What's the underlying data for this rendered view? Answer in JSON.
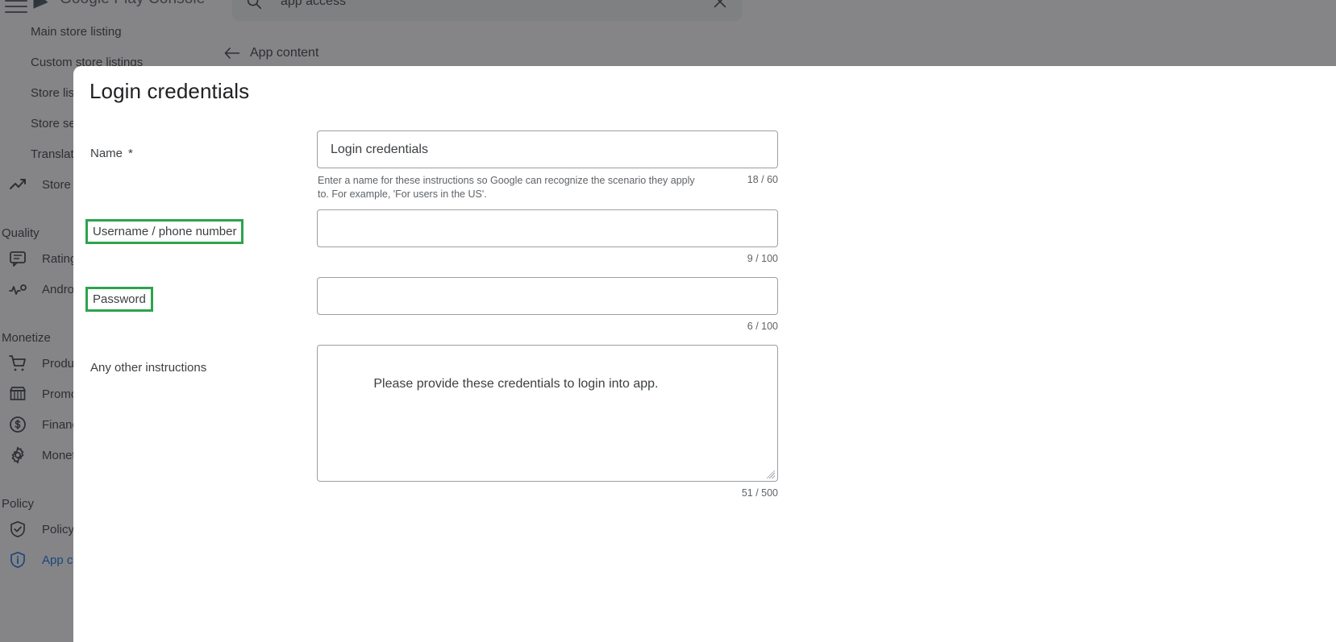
{
  "app": {
    "brand": "Google Play Console",
    "menu_icon": "hamburger-icon",
    "logo_icon": "google-play-logo"
  },
  "search": {
    "icon": "search-icon",
    "value": "app access",
    "clear_icon": "close-icon"
  },
  "breadcrumb": {
    "back_icon": "arrow-left-icon",
    "label": "App content"
  },
  "sidebar": {
    "items": [
      {
        "label": "Main store listing",
        "icon": "",
        "type": "sub",
        "active": false
      },
      {
        "label": "Custom store listings",
        "icon": "",
        "type": "sub",
        "active": false
      },
      {
        "label": "Store listing experiments",
        "icon": "",
        "type": "sub",
        "active": false
      },
      {
        "label": "Store settings",
        "icon": "",
        "type": "sub",
        "active": false
      },
      {
        "label": "Translation service",
        "icon": "",
        "type": "sub",
        "active": false
      },
      {
        "label": "Store performance",
        "icon": "trending-up-icon",
        "type": "item",
        "active": false
      }
    ],
    "sections": [
      {
        "title": "Quality",
        "items": [
          {
            "label": "Ratings and reviews",
            "icon": "reviews-icon",
            "active": false
          },
          {
            "label": "Android vitals",
            "icon": "vitals-icon",
            "active": false
          }
        ]
      },
      {
        "title": "Monetize",
        "items": [
          {
            "label": "Products",
            "icon": "cart-icon",
            "active": false
          },
          {
            "label": "Promo content",
            "icon": "store-icon",
            "active": false
          },
          {
            "label": "Financial reports",
            "icon": "dollar-icon",
            "active": false
          },
          {
            "label": "Monetization setup",
            "icon": "gear-icon",
            "active": false
          }
        ]
      },
      {
        "title": "Policy",
        "items": [
          {
            "label": "Policy status",
            "icon": "shield-check-icon",
            "active": false
          },
          {
            "label": "App content",
            "icon": "info-icon",
            "active": true
          }
        ]
      }
    ]
  },
  "dialog": {
    "title": "Login credentials",
    "fields": [
      {
        "label": "Name",
        "required_mark": "*",
        "value": "Login credentials",
        "placeholder": "",
        "helper": "Enter a name for these instructions so Google can recognize the scenario they apply to. For example, 'For users in the US'.",
        "counter": "18 / 60",
        "highlighted": false,
        "kind": "text"
      },
      {
        "label": "Username / phone number",
        "required_mark": "",
        "value": "",
        "placeholder": "",
        "helper": "",
        "counter": "9 / 100",
        "highlighted": true,
        "kind": "text"
      },
      {
        "label": "Password",
        "required_mark": "",
        "value": "",
        "placeholder": "",
        "helper": "",
        "counter": "6 / 100",
        "highlighted": true,
        "kind": "text"
      },
      {
        "label": "Any other instructions",
        "required_mark": "",
        "value": "Please provide these credentials to login into app.",
        "placeholder": "",
        "helper": "",
        "counter": "51 / 500",
        "highlighted": false,
        "kind": "textarea"
      }
    ]
  },
  "colors": {
    "highlight_green": "#2EA34E",
    "accent_blue": "#1a73e8",
    "text_primary": "#202124",
    "text_secondary": "#5f6368",
    "border": "#9aa0a6",
    "scrim": "rgba(32,33,36,.55)"
  }
}
